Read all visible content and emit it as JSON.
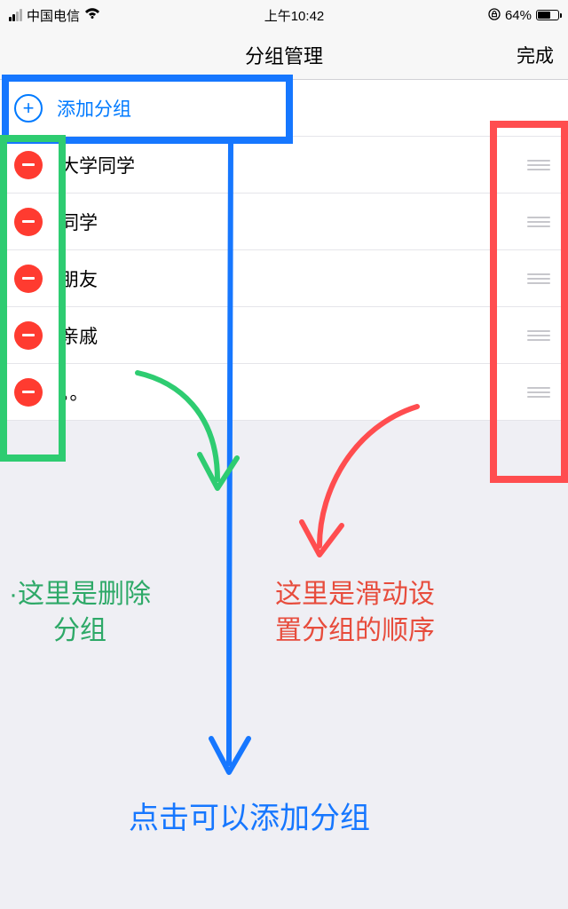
{
  "status_bar": {
    "carrier": "中国电信",
    "time": "上午10:42",
    "battery_pct": "64%"
  },
  "nav": {
    "title": "分组管理",
    "done": "完成"
  },
  "add_group": {
    "label": "添加分组"
  },
  "groups": [
    {
      "label": "大学同学"
    },
    {
      "label": "同学"
    },
    {
      "label": "朋友"
    },
    {
      "label": "亲戚"
    },
    {
      "label": "。。"
    }
  ],
  "annotations": {
    "delete_hint": "·这里是删除\n分组",
    "drag_hint": "这里是滑动设\n置分组的顺序",
    "add_hint": "点击可以添加分组",
    "colors": {
      "blue_box": "#1677ff",
      "green_box": "#2ecc71",
      "red_box": "#ff4d4f",
      "green_text": "#2ea968",
      "red_text": "#e74c3c",
      "blue_text": "#1677ff"
    }
  }
}
